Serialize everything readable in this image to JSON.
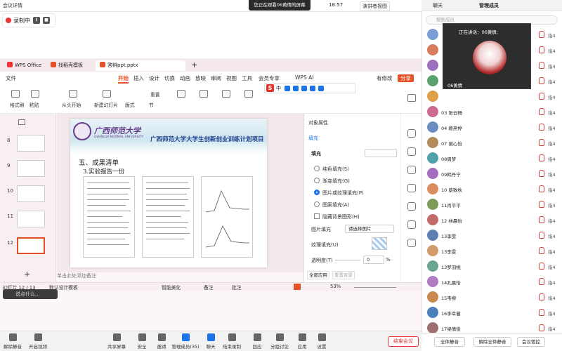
{
  "meeting": {
    "info_label": "会议详情",
    "sharing_banner": "您正在观看06黄倩的屏幕",
    "clock": "18:57",
    "presenter_view": "演讲者视图",
    "recording_label": "录制中"
  },
  "toolbar": {
    "mute": "解除静音",
    "video": "开启视频",
    "share": "共享屏幕",
    "security": "安全",
    "invite": "邀请",
    "participants": "管理成员(35)",
    "chat": "聊天",
    "record": "结束录制",
    "reactions": "回应",
    "breakout": "分组讨论",
    "apps": "应用",
    "settings": "设置",
    "end": "结束会议"
  },
  "wps": {
    "tabs": [
      "WPS Office",
      "找稻壳模板",
      "答辩ppt.pptx"
    ],
    "menus": [
      "文件",
      "开始",
      "插入",
      "设计",
      "切换",
      "动画",
      "放映",
      "审阅",
      "视图",
      "工具",
      "会员专享",
      "WPS AI",
      "有修改",
      "分享"
    ],
    "ribbon": [
      "格式刷",
      "粘贴",
      "从头开始",
      "新建幻灯片",
      "版式",
      "节",
      "重置"
    ],
    "ime": "中",
    "slide_numbers": [
      "8",
      "9",
      "10",
      "11",
      "12"
    ],
    "slide": {
      "univ_cn": "广西师范大学",
      "univ_en": "GUANGXI NORMAL UNIVERSITY",
      "project": "广西师范大学大学生创新创业训练计划项目",
      "section": "五、成果清单",
      "sub": "3.实验报告一份"
    },
    "notes_placeholder": "单击此处添加备注",
    "panel": {
      "title": "对象属性",
      "tab": "填充",
      "fill": "填充",
      "opt_none": "纯色填充(S)",
      "opt_grad": "渐变填充(G)",
      "opt_pic": "图片或纹理填充(P)",
      "opt_pattern": "图案填充(A)",
      "hide_bg": "隐藏背景图形(H)",
      "pic_fill": "图片填充",
      "pic_select": "请选择图片",
      "tex_fill": "纹理填充(U)",
      "transparency": "透明度(T)",
      "transparency_val": "0",
      "pct": "%",
      "apply_all": "全部应用",
      "reset_bg": "重置背景"
    },
    "status": {
      "slide": "幻灯片 12 / 13",
      "theme": "默认设计模板",
      "beautify": "智能美化",
      "notes": "备注",
      "comments": "批注",
      "zoom": "53%"
    },
    "chat_hint": "说点什么..."
  },
  "participants": {
    "tabs": [
      "聊天",
      "管理成员"
    ],
    "search_placeholder": "搜索成员",
    "speaking_label": "正在讲话：06黄倩;",
    "speaker_name": "06黄倩",
    "act_label": "指4",
    "list": [
      "",
      "",
      "",
      "",
      "",
      "03 张云畅",
      "04 赖燕婷",
      "07 谢心怡",
      "08周梦",
      "09韩丹宁",
      "10 蔡致秋",
      "11肖平平",
      "12 林晨怡",
      "13李雯",
      "13李雯",
      "13罗羽桃",
      "14孔晨怡",
      "15韦柳",
      "16李幸蔓",
      "17梁倩俊"
    ],
    "colors": [
      "#7b9fd4",
      "#d97b5e",
      "#9c6fbf",
      "#5aa36f",
      "#e0a04a",
      "#cc6b8f",
      "#6c8ebf",
      "#b48b5c",
      "#4fa3a8",
      "#a36dc0",
      "#d98c5f",
      "#7c9b58",
      "#c26b6b",
      "#5c7fb0",
      "#d29b6a",
      "#6aa58f",
      "#b07cc4",
      "#c88a4e",
      "#4a7fb8",
      "#9e6f6f"
    ],
    "mute_all": "全体静音",
    "unmute_all": "解除全体静音",
    "manage": "会议管控"
  }
}
